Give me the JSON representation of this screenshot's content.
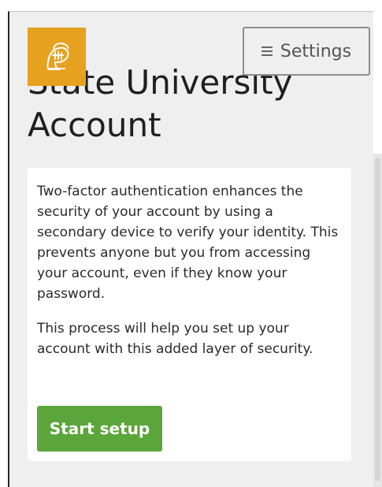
{
  "colors": {
    "background": "#efefef",
    "card": "#ffffff",
    "logo": "#e6a11e",
    "primary_button": "#5aa63a",
    "border": "#8d8d8d",
    "text": "#1f1f1f"
  },
  "header": {
    "logo_icon": "spartan-helmet-icon",
    "settings_label": "Settings"
  },
  "title": "State University Account",
  "card": {
    "paragraph_1": "Two-factor authentication enhances the security of your account by using a secondary device to verify your identity. This prevents anyone but you from accessing your account, even if they know your password.",
    "paragraph_2": "This process will help you set up your account with this added layer of security.",
    "button_label": "Start setup"
  }
}
